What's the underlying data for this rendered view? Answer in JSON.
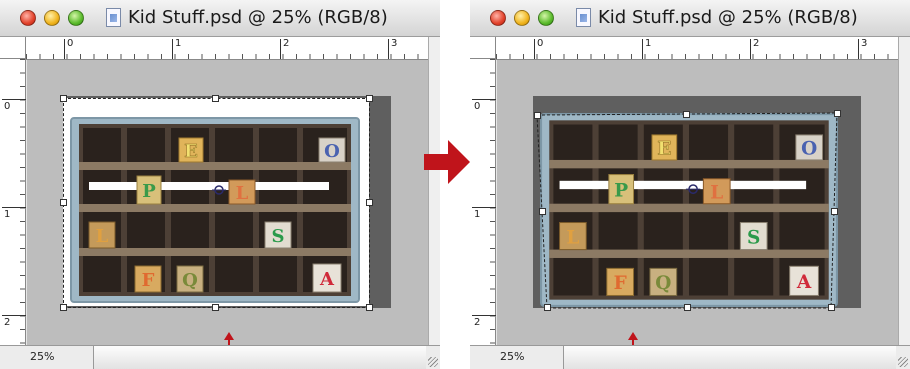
{
  "windows": [
    {
      "title": "Kid Stuff.psd @ 25% (RGB/8)",
      "zoom": "25%"
    },
    {
      "title": "Kid Stuff.psd @ 25% (RGB/8)",
      "zoom": "25%"
    }
  ],
  "ruler": {
    "h_labels": [
      "0",
      "1",
      "2",
      "3"
    ],
    "v_labels": [
      "0",
      "1",
      "2"
    ]
  },
  "blocks": [
    "E",
    "O",
    "P",
    "L",
    "L",
    "S",
    "F",
    "Q",
    "A"
  ],
  "colors": {
    "canvas_gray": "#bdbdbd",
    "arrow_red": "#c0141b",
    "shelf_wood": "#6b5a48",
    "shelf_paint": "#a9c4d4"
  }
}
